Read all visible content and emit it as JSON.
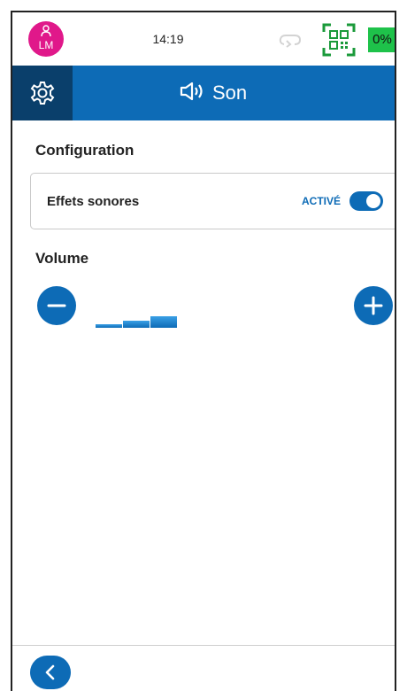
{
  "status": {
    "avatar_initials": "LM",
    "time": "14:19",
    "battery": "0%",
    "colors": {
      "avatar": "#e0188a",
      "battery": "#1ec24a",
      "qr": "#1a9a3a"
    }
  },
  "header": {
    "title": "Son",
    "title_icon": "speaker-icon",
    "settings_icon": "gear-icon",
    "colors": {
      "bar": "#0d6bb6",
      "settings_bg": "#0a3f6b"
    }
  },
  "configuration": {
    "title": "Configuration",
    "sound_effects": {
      "label": "Effets sonores",
      "state": "ACTIVÉ",
      "enabled": true
    }
  },
  "volume": {
    "title": "Volume",
    "decrease_icon": "minus-icon",
    "increase_icon": "plus-icon",
    "level": 3,
    "max_level": 3
  },
  "footer": {
    "back_icon": "chevron-left-icon"
  }
}
